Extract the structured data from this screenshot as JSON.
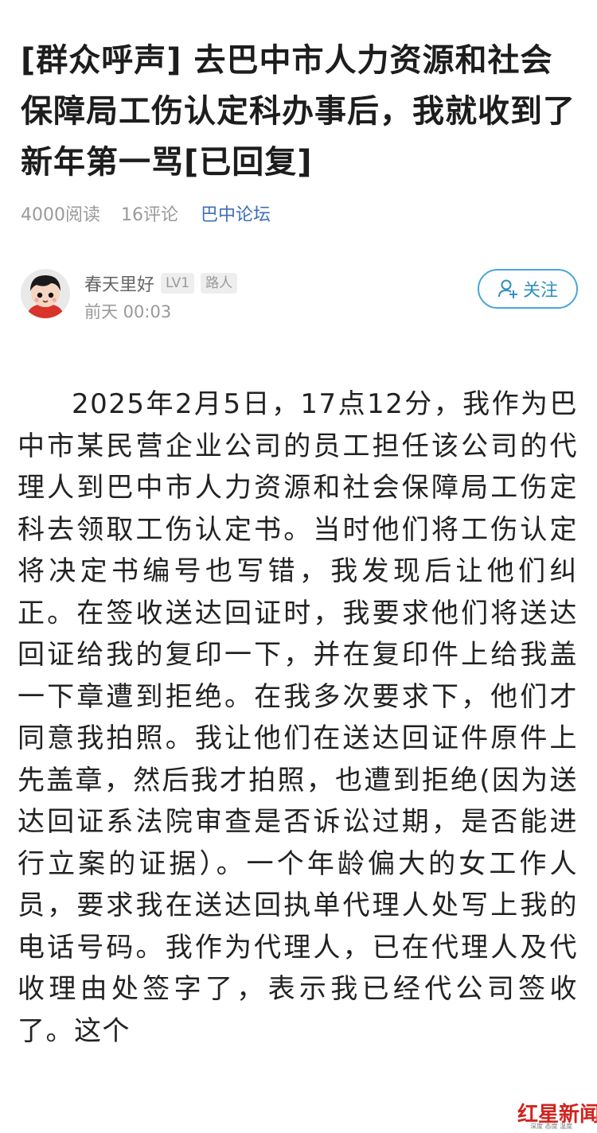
{
  "post": {
    "title": "[群众呼声] 去巴中市人力资源和社会保障局工伤认定科办事后，我就收到了新年第一骂[已回复]",
    "reads": "4000阅读",
    "comments": "16评论",
    "forum": "巴中论坛"
  },
  "author": {
    "name": "春天里好",
    "level": "LV1",
    "rank": "路人",
    "time": "前天 00:03",
    "follow_label": "关注"
  },
  "content": {
    "text": "2025年2月5日，17点12分，我作为巴中市某民营企业公司的员工担任该公司的代理人到巴中市人力资源和社会保障局工伤定科去领取工伤认定书。当时他们将工伤认定将决定书编号也写错，我发现后让他们纠正。在签收送达回证时，我要求他们将送达回证给我的复印一下，并在复印件上给我盖一下章遭到拒绝。在我多次要求下，他们才同意我拍照。我让他们在送达回证件原件上先盖章，然后我才拍照，也遭到拒绝(因为送达回证系法院审查是否诉讼过期，是否能进行立案的证据）。一个年龄偏大的女工作人员，要求我在送达回执单代理人处写上我的电话号码。我作为代理人，已在代理人及代收理由处签字了，表示我已经代公司签收了。这个"
  },
  "watermark": {
    "logo": "红星新闻",
    "sub": "深度 态度 温度"
  },
  "colors": {
    "accent": "#3d6fb8",
    "follow": "#2f8fc2",
    "watermark": "#d0241e"
  }
}
